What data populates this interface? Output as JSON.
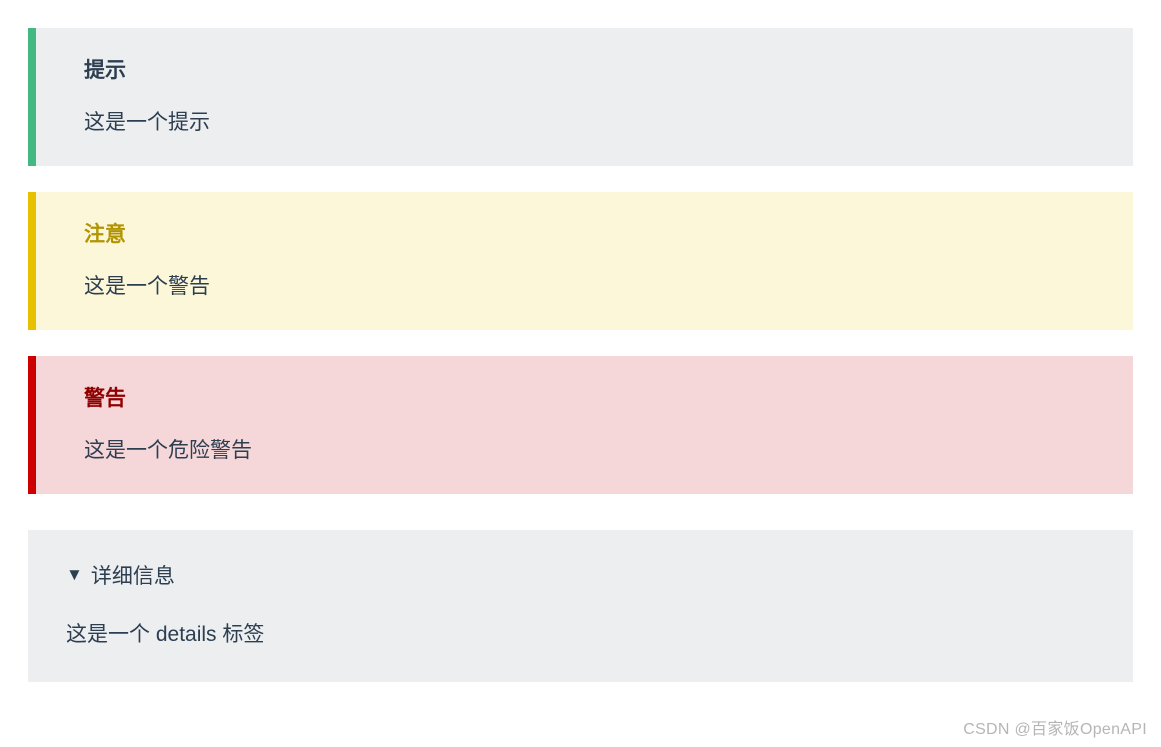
{
  "callouts": [
    {
      "type": "tip",
      "title": "提示",
      "body": "这是一个提示"
    },
    {
      "type": "warning",
      "title": "注意",
      "body": "这是一个警告"
    },
    {
      "type": "danger",
      "title": "警告",
      "body": "这是一个危险警告"
    }
  ],
  "details": {
    "summary": "详细信息",
    "body": "这是一个 details 标签"
  },
  "watermark": "CSDN @百家饭OpenAPI"
}
